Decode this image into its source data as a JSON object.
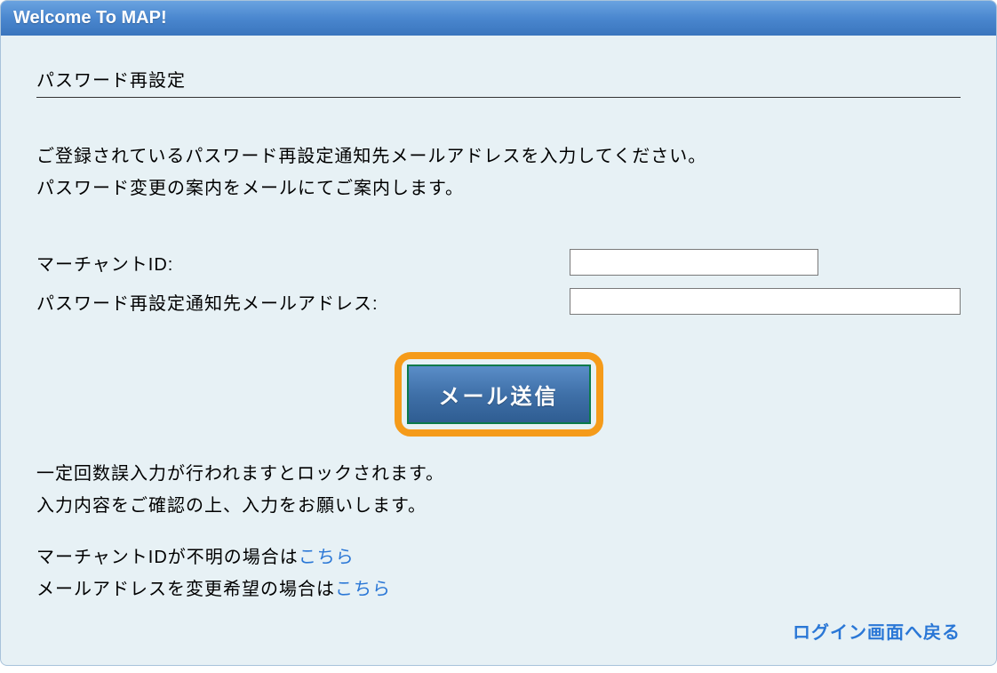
{
  "header": {
    "title": "Welcome To MAP!"
  },
  "section": {
    "title": "パスワード再設定"
  },
  "instruction": {
    "line1": "ご登録されているパスワード再設定通知先メールアドレスを入力してください。",
    "line2": "パスワード変更の案内をメールにてご案内します。"
  },
  "form": {
    "merchant_label": "マーチャントID:",
    "merchant_value": "",
    "email_label": "パスワード再設定通知先メールアドレス:",
    "email_value": ""
  },
  "button": {
    "send_label": "メール送信"
  },
  "warning": {
    "line1": "一定回数誤入力が行われますとロックされます。",
    "line2": "入力内容をご確認の上、入力をお願いします。"
  },
  "help": {
    "merchant_prefix": "マーチャントIDが不明の場合は",
    "merchant_link": "こちら",
    "email_prefix": "メールアドレスを変更希望の場合は",
    "email_link": "こちら"
  },
  "footer": {
    "back_label": "ログイン画面へ戻る"
  }
}
